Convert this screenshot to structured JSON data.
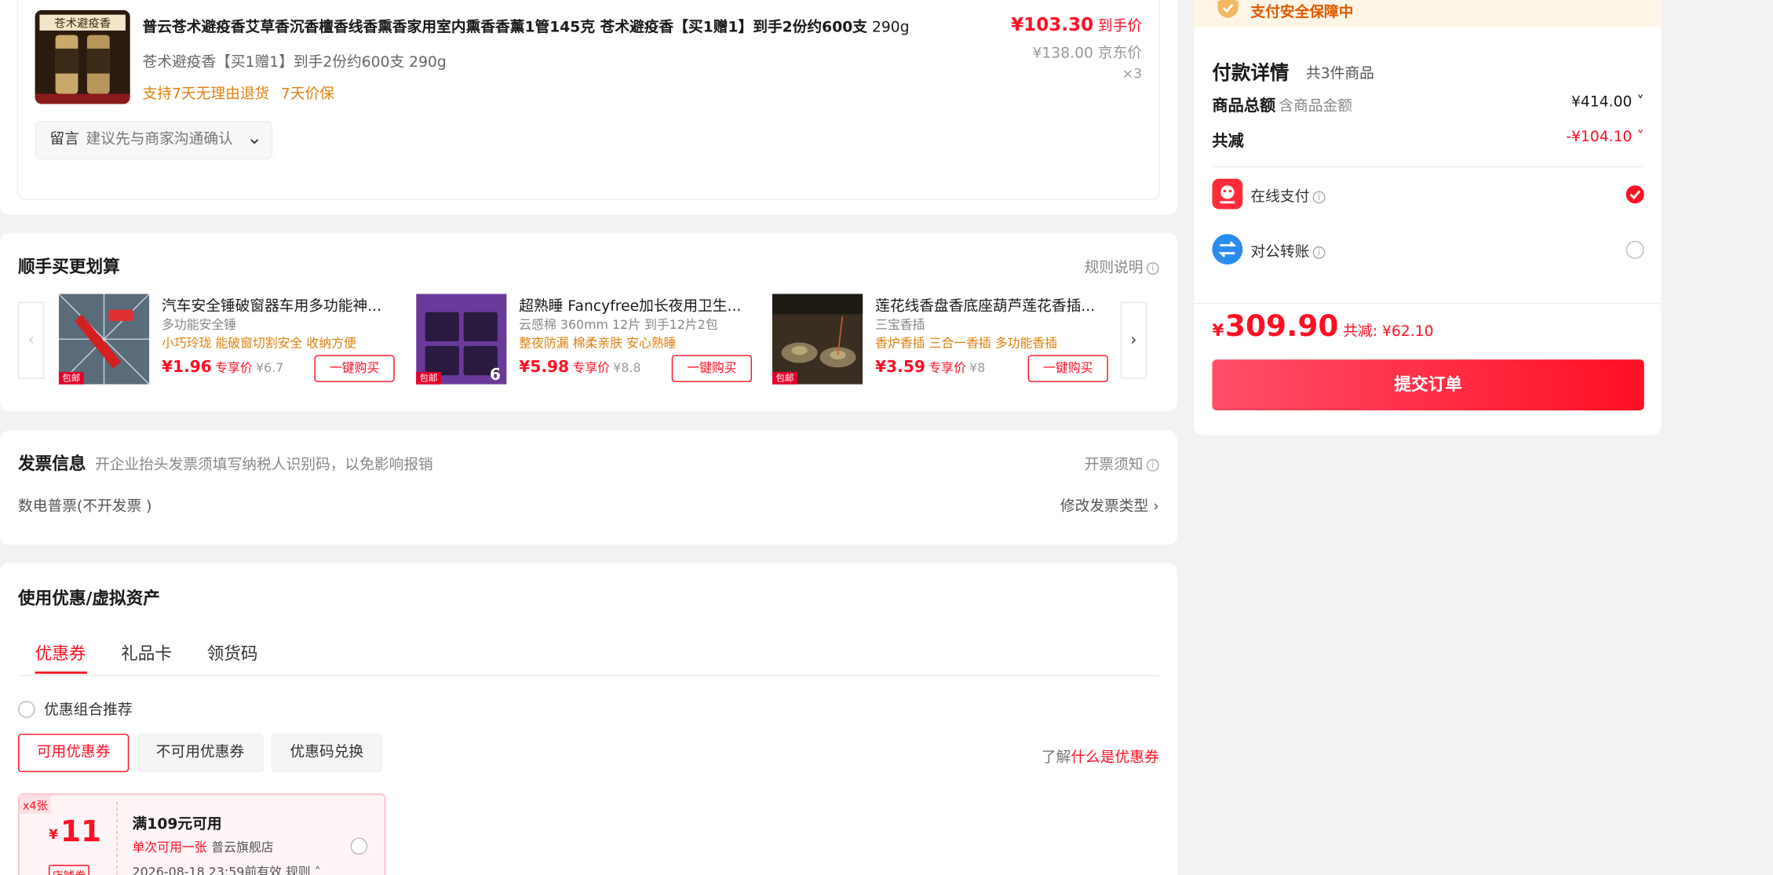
{
  "product": {
    "thumb_text": "苍术避疫香",
    "title_bold": "普云苍术避疫香艾草香沉香檀香线香熏香家用室内熏香香薰1管145克 苍术避疫香【买1赠1】到手2份约600支",
    "title_weight": " 290g",
    "sku": "苍术避疫香【买1赠1】到手2份约600支 290g",
    "services": [
      "支持7天无理由退货",
      "7天价保"
    ],
    "price": "¥103.30",
    "price_label": "到手价",
    "jd_price": "¥138.00",
    "jd_label": "京东价",
    "qty": "×3",
    "note_label": "留言",
    "note_placeholder": "建议先与商家沟通确认"
  },
  "addon": {
    "title": "顺手买更划算",
    "rule_link": "规则说明",
    "items": [
      {
        "name": "汽车安全锤破窗器车用多功能神...",
        "sub": "多功能安全锤",
        "tags": "小巧玲珑 能破窗切割安全 收纳方便",
        "price": "¥1.96",
        "price_label": "专享价",
        "orig": "¥6.7",
        "buy": "一键购买",
        "badge": "包邮"
      },
      {
        "name": "超熟睡 Fancyfree加长夜用卫生...",
        "sub": "云感棉 360mm 12片 到手12片2包",
        "tags": "整夜防漏 棉柔亲肤 安心熟睡",
        "price": "¥5.98",
        "price_label": "专享价",
        "orig": "¥8.8",
        "buy": "一键购买",
        "badge": "包邮"
      },
      {
        "name": "莲花线香盘香底座葫芦莲花香插...",
        "sub": "三宝香插",
        "tags": "香炉香插 三合一香插 多功能香插",
        "price": "¥3.59",
        "price_label": "专享价",
        "orig": "¥8",
        "buy": "一键购买",
        "badge": "包邮"
      }
    ]
  },
  "invoice": {
    "title": "发票信息",
    "hint": "开企业抬头发票须填写纳税人识别码，以免影响报销",
    "notice": "开票须知",
    "type": "数电普票(不开发票 )",
    "change": "修改发票类型"
  },
  "coupons": {
    "title": "使用优惠/虚拟资产",
    "tabs": [
      "优惠券",
      "礼品卡",
      "领货码"
    ],
    "combo": "优惠组合推荐",
    "filters": [
      "可用优惠券",
      "不可用优惠券",
      "优惠码兑换"
    ],
    "what_prefix": "了解",
    "what_link": "什么是优惠券",
    "tile": {
      "count": "x4张",
      "currency": "¥",
      "amount": "11",
      "tag": "店铺券",
      "condition": "满109元可用",
      "usage": "单次可用一张",
      "shop": "普云旗舰店",
      "expiry": "2026-08-18 23:59前有效",
      "rules": "规则"
    }
  },
  "pay": {
    "secure": "支付安全保障中",
    "title": "付款详情",
    "count": "共3件商品",
    "total_label": "商品总额",
    "total_sub": "含商品金额",
    "total_value": "¥414.00",
    "discount_label": "共减",
    "discount_value": "-¥104.10",
    "methods": [
      "在线支付",
      "对公转账"
    ],
    "currency": "¥",
    "final": "309.90",
    "saved": "共减: ¥62.10",
    "submit": "提交订单"
  },
  "colors": {
    "accent": "#ff0f23",
    "orange": "#e08010",
    "secure_bg": "#fff5e6"
  }
}
